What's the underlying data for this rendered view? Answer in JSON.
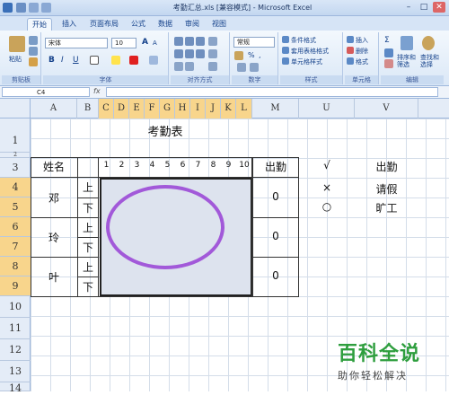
{
  "window": {
    "title": "考勤汇总.xls [兼容模式] - Microsoft Excel",
    "min": "–",
    "max": "□",
    "close": "✕"
  },
  "tabs": [
    "开始",
    "插入",
    "页面布局",
    "公式",
    "数据",
    "审阅",
    "视图"
  ],
  "ribbon": {
    "clipboard": {
      "paste": "粘贴",
      "label": "剪贴板"
    },
    "font": {
      "name": "宋体",
      "size": "10",
      "bold": "B",
      "italic": "I",
      "underline": "U",
      "label": "字体",
      "grow": "A",
      "shrink": "A"
    },
    "align": {
      "label": "对齐方式"
    },
    "number": {
      "format": "常规",
      "label": "数字",
      "percent": "%",
      "comma": ","
    },
    "styles": {
      "cond": "条件格式",
      "table": "套用表格格式",
      "cell": "单元格样式",
      "label": "样式"
    },
    "cells": {
      "insert": "插入",
      "delete": "删除",
      "format": "格式",
      "label": "单元格"
    },
    "edit": {
      "sigma": "Σ",
      "sort": "排序和筛选",
      "find": "查找和选择",
      "label": "编辑"
    }
  },
  "formula": {
    "namebox": "C4",
    "fx": "fx",
    "value": ""
  },
  "columns": [
    "A",
    "B",
    "C",
    "D",
    "E",
    "F",
    "G",
    "H",
    "I",
    "J",
    "K",
    "L",
    "M",
    "U",
    "V"
  ],
  "rows": [
    "1",
    "2",
    "3",
    "4",
    "5",
    "6",
    "7",
    "8",
    "9",
    "10",
    "11",
    "12",
    "13",
    "14"
  ],
  "sheet": {
    "title": "考勤表",
    "name_header": "姓名",
    "days": [
      "1",
      "2",
      "3",
      "4",
      "5",
      "6",
      "7",
      "8",
      "9",
      "10"
    ],
    "attend_header": "出勤",
    "people": [
      {
        "name": "邓",
        "am": "上",
        "pm": "下",
        "attend": "0"
      },
      {
        "name": "玲",
        "am": "上",
        "pm": "下",
        "attend": "0"
      },
      {
        "name": "叶",
        "am": "上",
        "pm": "下",
        "attend": "0"
      }
    ],
    "legend": [
      {
        "symbol": "√",
        "meaning": "出勤"
      },
      {
        "symbol": "×",
        "meaning": "请假"
      },
      {
        "symbol": "○",
        "meaning": "旷工"
      }
    ]
  },
  "watermark": {
    "main": "百科全说",
    "sub": "助你轻松解决"
  },
  "colors": {
    "ellipse": "#a259d9",
    "selected_header": "#f8d58c",
    "watermark": "#2e9e3e"
  }
}
